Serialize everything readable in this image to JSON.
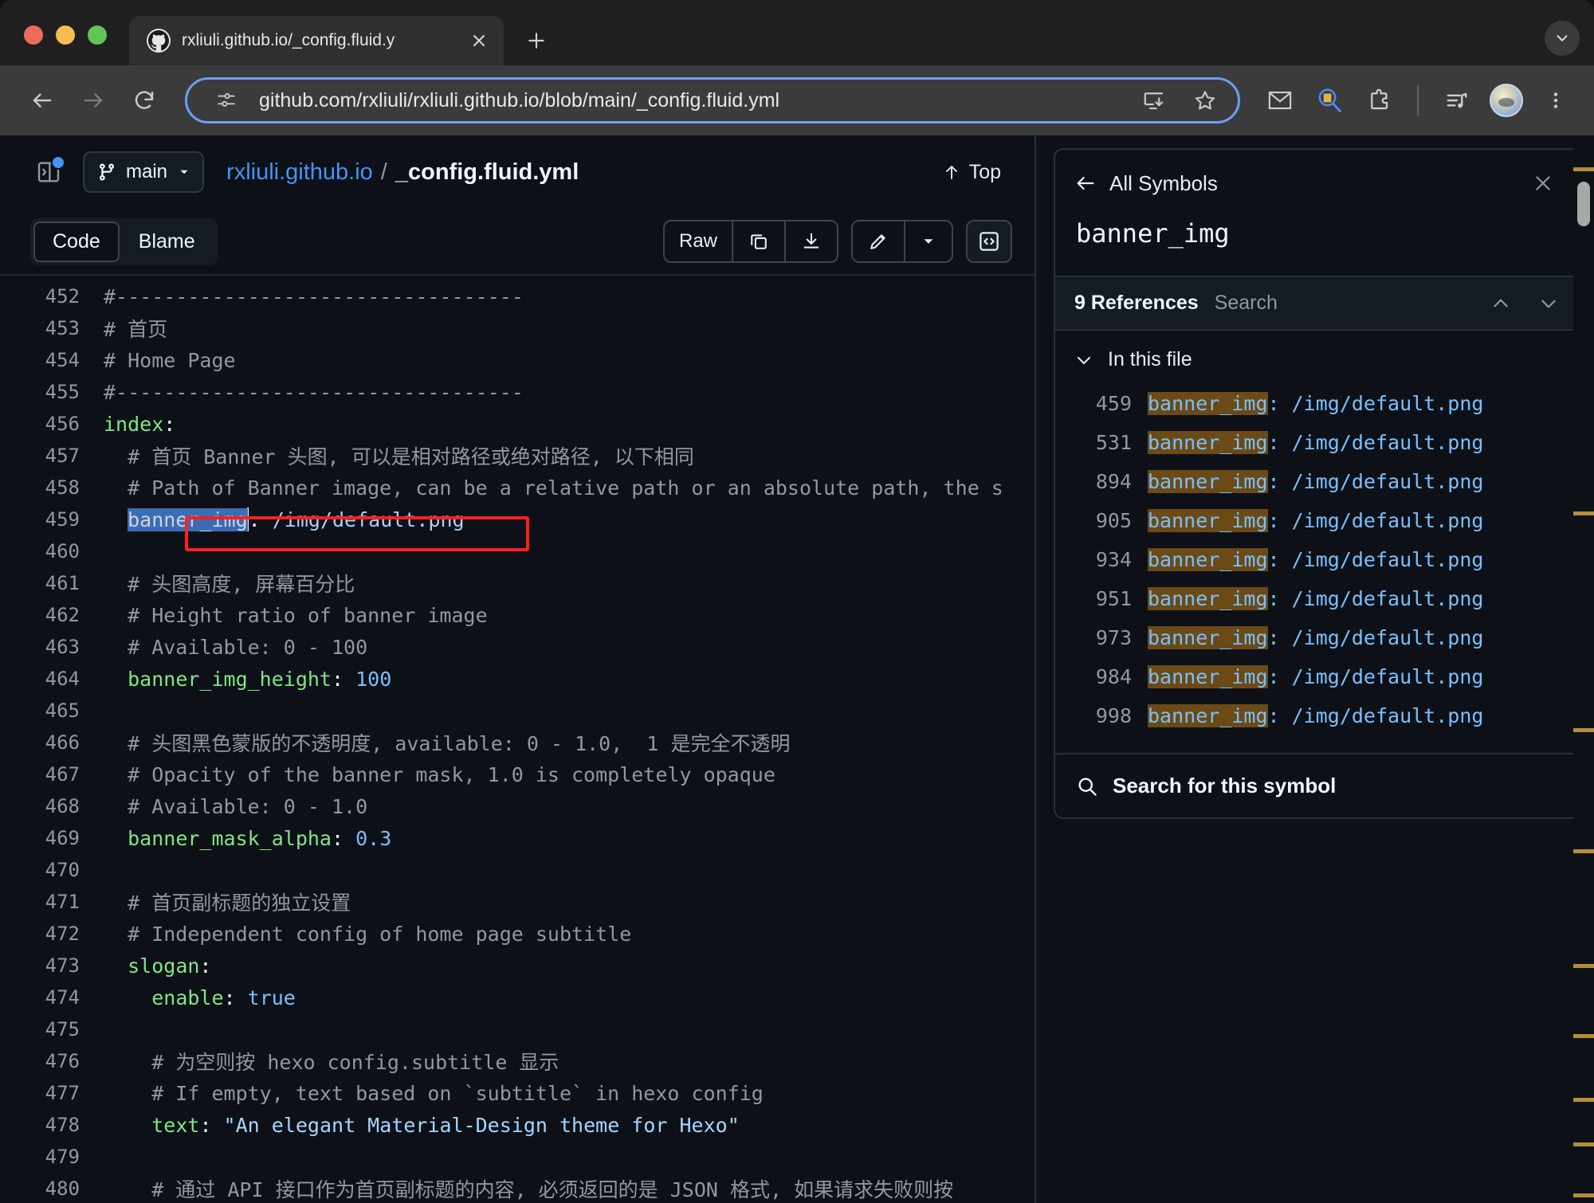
{
  "browser": {
    "tab": {
      "title": "rxliuli.github.io/_config.fluid.y",
      "favicon_icon": "github-icon",
      "close_icon": "close-icon"
    },
    "new_tab_icon": "plus-icon",
    "tab_list_icon": "chevron-down-icon",
    "nav": {
      "back_icon": "back-arrow-icon",
      "forward_icon": "forward-arrow-icon",
      "reload_icon": "reload-icon"
    },
    "omnibox": {
      "url": "github.com/rxliuli/rxliuli.github.io/blob/main/_config.fluid.yml",
      "site_info_icon": "page-settings-icon",
      "install_icon": "install-app-icon",
      "bookmark_icon": "star-icon"
    },
    "actions": [
      {
        "icon": "mail-icon",
        "name": "mail-extension-button"
      },
      {
        "icon": "search-doc-icon",
        "name": "search-extension-button"
      },
      {
        "icon": "puzzle-icon",
        "name": "extensions-button"
      },
      {
        "icon": "media-list-icon",
        "name": "media-list-button"
      }
    ],
    "avatar_icon": "profile-avatar",
    "menu_icon": "kebab-menu-icon",
    "accent": "#6b9ef5"
  },
  "file_header": {
    "sidebar_toggle_icon": "file-tree-icon",
    "branch": {
      "label": "main",
      "icon": "branch-icon",
      "caret_icon": "chevron-down-icon"
    },
    "repo": "rxliuli.github.io",
    "separator": "/",
    "filename": "_config.fluid.yml",
    "top_button": {
      "label": "Top",
      "icon": "up-arrow-icon"
    }
  },
  "view_tabs": {
    "items": [
      {
        "label": "Code",
        "active": true
      },
      {
        "label": "Blame",
        "active": false
      }
    ],
    "raw_label": "Raw",
    "copy_icon": "copy-icon",
    "download_icon": "download-icon",
    "edit_icon": "pencil-icon",
    "edit_caret_icon": "chevron-down-icon",
    "symbols_icon": "code-brackets-icon"
  },
  "code": {
    "lines": [
      {
        "n": "452",
        "segs": [
          {
            "t": "#----------------------------------",
            "c": "lc"
          }
        ]
      },
      {
        "n": "453",
        "segs": [
          {
            "t": "# 首页",
            "c": "lc"
          }
        ]
      },
      {
        "n": "454",
        "segs": [
          {
            "t": "# Home Page",
            "c": "lc"
          }
        ]
      },
      {
        "n": "455",
        "segs": [
          {
            "t": "#----------------------------------",
            "c": "lc"
          }
        ]
      },
      {
        "n": "456",
        "segs": [
          {
            "t": "index",
            "c": "lk"
          },
          {
            "t": ":",
            "c": "lp"
          }
        ]
      },
      {
        "n": "457",
        "segs": [
          {
            "t": "  # 首页 Banner 头图, 可以是相对路径或绝对路径, 以下相同",
            "c": "lc"
          }
        ]
      },
      {
        "n": "458",
        "segs": [
          {
            "t": "  # Path of Banner image, can be a relative path or an absolute path, the s",
            "c": "lc"
          }
        ]
      },
      {
        "n": "459",
        "selected": true,
        "segs": [
          {
            "t": "  ",
            "c": "lp"
          },
          {
            "t": "banner_img",
            "c": "sel"
          },
          {
            "t": ":",
            "c": "lp"
          },
          {
            "t": " /img/default.png",
            "c": "ls"
          }
        ]
      },
      {
        "n": "460",
        "segs": []
      },
      {
        "n": "461",
        "segs": [
          {
            "t": "  # 头图高度, 屏幕百分比",
            "c": "lc"
          }
        ]
      },
      {
        "n": "462",
        "segs": [
          {
            "t": "  # Height ratio of banner image",
            "c": "lc"
          }
        ]
      },
      {
        "n": "463",
        "segs": [
          {
            "t": "  # Available: 0 - 100",
            "c": "lc"
          }
        ]
      },
      {
        "n": "464",
        "segs": [
          {
            "t": "  ",
            "c": "lp"
          },
          {
            "t": "banner_img_height",
            "c": "lk"
          },
          {
            "t": ":",
            "c": "lp"
          },
          {
            "t": " 100",
            "c": "lv"
          }
        ]
      },
      {
        "n": "465",
        "segs": []
      },
      {
        "n": "466",
        "segs": [
          {
            "t": "  # 头图黑色蒙版的不透明度, available: 0 - 1.0,  1 是完全不透明",
            "c": "lc"
          }
        ]
      },
      {
        "n": "467",
        "segs": [
          {
            "t": "  # Opacity of the banner mask, 1.0 is completely opaque",
            "c": "lc"
          }
        ]
      },
      {
        "n": "468",
        "segs": [
          {
            "t": "  # Available: 0 - 1.0",
            "c": "lc"
          }
        ]
      },
      {
        "n": "469",
        "segs": [
          {
            "t": "  ",
            "c": "lp"
          },
          {
            "t": "banner_mask_alpha",
            "c": "lk"
          },
          {
            "t": ":",
            "c": "lp"
          },
          {
            "t": " 0.3",
            "c": "lv"
          }
        ]
      },
      {
        "n": "470",
        "segs": []
      },
      {
        "n": "471",
        "segs": [
          {
            "t": "  # 首页副标题的独立设置",
            "c": "lc"
          }
        ]
      },
      {
        "n": "472",
        "segs": [
          {
            "t": "  # Independent config of home page subtitle",
            "c": "lc"
          }
        ]
      },
      {
        "n": "473",
        "segs": [
          {
            "t": "  ",
            "c": "lp"
          },
          {
            "t": "slogan",
            "c": "lk"
          },
          {
            "t": ":",
            "c": "lp"
          }
        ]
      },
      {
        "n": "474",
        "segs": [
          {
            "t": "    ",
            "c": "lp"
          },
          {
            "t": "enable",
            "c": "lk"
          },
          {
            "t": ":",
            "c": "lp"
          },
          {
            "t": " true",
            "c": "lv"
          }
        ]
      },
      {
        "n": "475",
        "segs": []
      },
      {
        "n": "476",
        "segs": [
          {
            "t": "    # 为空则按 hexo config.subtitle 显示",
            "c": "lc"
          }
        ]
      },
      {
        "n": "477",
        "segs": [
          {
            "t": "    # If empty, text based on `subtitle` in hexo config",
            "c": "lc"
          }
        ]
      },
      {
        "n": "478",
        "segs": [
          {
            "t": "    ",
            "c": "lp"
          },
          {
            "t": "text",
            "c": "lk"
          },
          {
            "t": ":",
            "c": "lp"
          },
          {
            "t": " \"An elegant Material-Design theme for Hexo\"",
            "c": "ls"
          }
        ]
      },
      {
        "n": "479",
        "segs": []
      },
      {
        "n": "480",
        "segs": [
          {
            "t": "    # 通过 API 接口作为首页副标题的内容, 必须返回的是 JSON 格式, 如果请求失败则按",
            "c": "lc"
          }
        ]
      }
    ],
    "annotation_color": "#fb1f1f"
  },
  "symbols_panel": {
    "back_label": "All Symbols",
    "back_icon": "back-arrow-icon",
    "close_icon": "close-icon",
    "symbol_name": "banner_img",
    "references_count": "9 References",
    "search_tab": "Search",
    "prev_icon": "chevron-up-icon",
    "next_icon": "chevron-down-icon",
    "group_label": "In this file",
    "group_caret_icon": "chevron-down-icon",
    "references": [
      {
        "line": "459",
        "symbol": "banner_img",
        "rest": ": /img/default.png"
      },
      {
        "line": "531",
        "symbol": "banner_img",
        "rest": ": /img/default.png"
      },
      {
        "line": "894",
        "symbol": "banner_img",
        "rest": ": /img/default.png"
      },
      {
        "line": "905",
        "symbol": "banner_img",
        "rest": ": /img/default.png"
      },
      {
        "line": "934",
        "symbol": "banner_img",
        "rest": ": /img/default.png"
      },
      {
        "line": "951",
        "symbol": "banner_img",
        "rest": ": /img/default.png"
      },
      {
        "line": "973",
        "symbol": "banner_img",
        "rest": ": /img/default.png"
      },
      {
        "line": "984",
        "symbol": "banner_img",
        "rest": ": /img/default.png"
      },
      {
        "line": "998",
        "symbol": "banner_img",
        "rest": ": /img/default.png"
      }
    ],
    "footer_label": "Search for this symbol",
    "footer_icon": "search-icon",
    "highlight_color": "#6b4a16",
    "link_color": "#79c0ff"
  },
  "scrollbar": {
    "marker_color": "#b58d3a",
    "marker_positions": [
      5,
      59,
      93,
      112,
      130,
      141,
      151,
      158,
      166
    ]
  }
}
